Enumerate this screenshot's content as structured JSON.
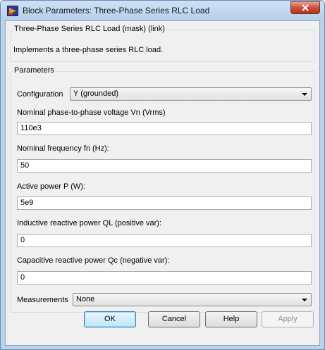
{
  "window": {
    "title": "Block Parameters: Three-Phase Series RLC Load"
  },
  "description": {
    "group_title": "Three-Phase Series RLC Load (mask) (link)",
    "text": "Implements a three-phase series RLC load."
  },
  "parameters": {
    "group_title": "Parameters",
    "configuration": {
      "label": "Configuration",
      "value": "Y (grounded)"
    },
    "voltage": {
      "label": "Nominal phase-to-phase voltage Vn (Vrms)",
      "value": "110e3"
    },
    "frequency": {
      "label": "Nominal frequency fn (Hz):",
      "value": "50"
    },
    "active_power": {
      "label": "Active power P (W):",
      "value": "5e9"
    },
    "inductive_power": {
      "label": "Inductive reactive power QL (positive var):",
      "value": "0"
    },
    "capacitive_power": {
      "label": "Capacitive reactive power Qc (negative var):",
      "value": "0"
    },
    "measurements": {
      "label": "Measurements",
      "value": "None"
    }
  },
  "buttons": {
    "ok": "OK",
    "cancel": "Cancel",
    "help": "Help",
    "apply": "Apply"
  },
  "colors": {
    "title_bar": "#b7cfeb",
    "close_button": "#c9503a",
    "dialog_background": "#f0f0f0",
    "default_button_border": "#3c7fb1"
  },
  "icons": {
    "app": "simulink-block-icon",
    "close": "close-icon",
    "dropdown": "chevron-down-icon"
  }
}
